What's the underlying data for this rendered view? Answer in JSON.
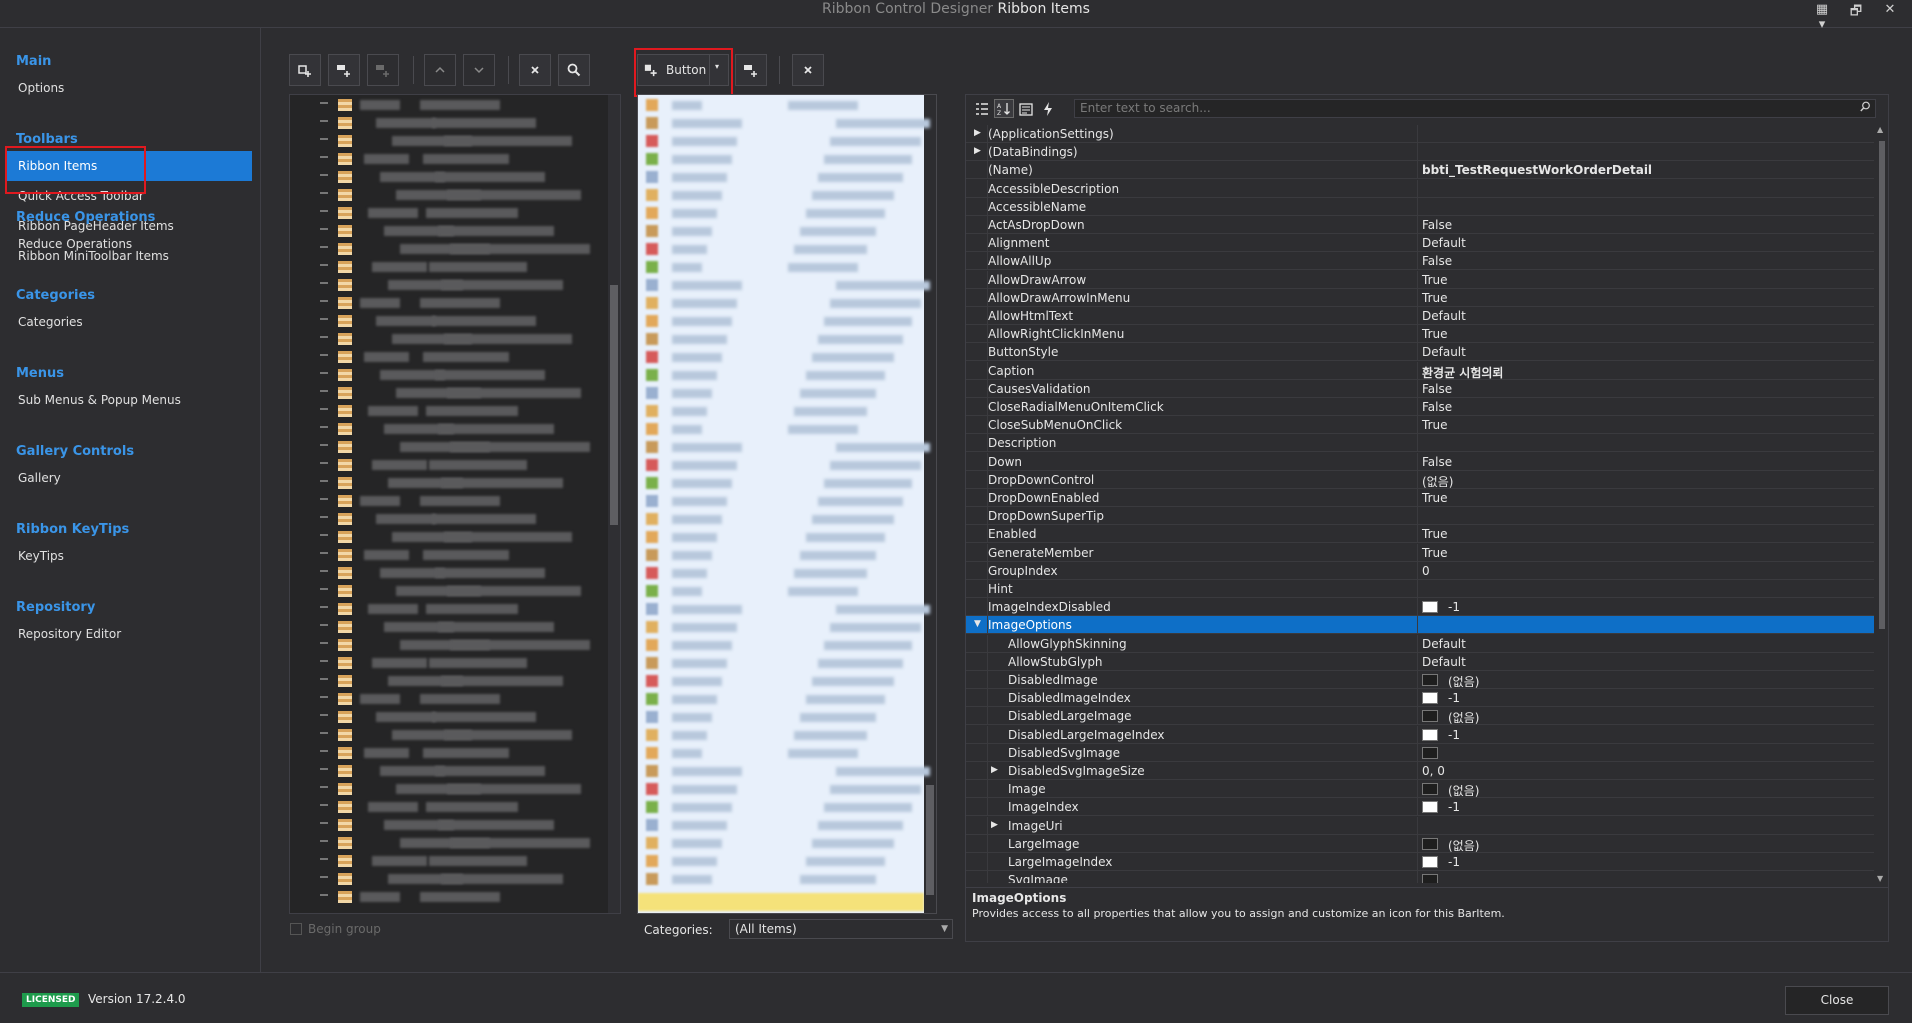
{
  "window": {
    "title_dim": "Ribbon Control Designer",
    "title_bright": "Ribbon Items",
    "buttons": [
      "▦ ▾",
      "🗗",
      "✕"
    ]
  },
  "sidebar": {
    "groups": [
      {
        "title": "Main",
        "items": [
          "Options"
        ]
      },
      {
        "title": "Toolbars",
        "items": [
          "Ribbon Items",
          "Quick Access Toolbar",
          "Ribbon PageHeader Items",
          "Ribbon MiniToolbar Items"
        ]
      },
      {
        "title": "Reduce Operations",
        "items": [
          "Reduce Operations"
        ]
      },
      {
        "title": "Categories",
        "items": [
          "Categories"
        ]
      },
      {
        "title": "Menus",
        "items": [
          "Sub Menus & Popup Menus"
        ]
      },
      {
        "title": "Gallery Controls",
        "items": [
          "Gallery"
        ]
      },
      {
        "title": "Ribbon KeyTips",
        "items": [
          "KeyTips"
        ]
      },
      {
        "title": "Repository",
        "items": [
          "Repository Editor"
        ]
      }
    ],
    "active_item": "Ribbon Items"
  },
  "toolbar": {
    "add_button_label": "Button",
    "add_icon": "add-item-icon",
    "remove_icon": "close-icon",
    "search_icon": "search-icon"
  },
  "left_panel": {
    "begin_group_label": "Begin group"
  },
  "middle_panel": {
    "categories_label": "Categories:",
    "categories_value": "(All Items)"
  },
  "properties": {
    "search_placeholder": "Enter text to search...",
    "rows": [
      {
        "name": "(ApplicationSettings)",
        "value": "",
        "expander": "▶",
        "indent": 0
      },
      {
        "name": "(DataBindings)",
        "value": "",
        "expander": "▶",
        "indent": 0
      },
      {
        "name": "(Name)",
        "value": "bbti_TestRequestWorkOrderDetail",
        "bold": true,
        "indent": 0
      },
      {
        "name": "AccessibleDescription",
        "value": "",
        "indent": 0
      },
      {
        "name": "AccessibleName",
        "value": "",
        "indent": 0
      },
      {
        "name": "ActAsDropDown",
        "value": "False",
        "indent": 0
      },
      {
        "name": "Alignment",
        "value": "Default",
        "indent": 0
      },
      {
        "name": "AllowAllUp",
        "value": "False",
        "indent": 0
      },
      {
        "name": "AllowDrawArrow",
        "value": "True",
        "indent": 0
      },
      {
        "name": "AllowDrawArrowInMenu",
        "value": "True",
        "indent": 0
      },
      {
        "name": "AllowHtmlText",
        "value": "Default",
        "indent": 0
      },
      {
        "name": "AllowRightClickInMenu",
        "value": "True",
        "indent": 0
      },
      {
        "name": "ButtonStyle",
        "value": "Default",
        "indent": 0
      },
      {
        "name": "Caption",
        "value": "환경균 시험의뢰",
        "bold": true,
        "indent": 0
      },
      {
        "name": "CausesValidation",
        "value": "False",
        "indent": 0
      },
      {
        "name": "CloseRadialMenuOnItemClick",
        "value": "False",
        "indent": 0
      },
      {
        "name": "CloseSubMenuOnClick",
        "value": "True",
        "indent": 0
      },
      {
        "name": "Description",
        "value": "",
        "indent": 0
      },
      {
        "name": "Down",
        "value": "False",
        "indent": 0
      },
      {
        "name": "DropDownControl",
        "value": "(없음)",
        "indent": 0
      },
      {
        "name": "DropDownEnabled",
        "value": "True",
        "indent": 0
      },
      {
        "name": "DropDownSuperTip",
        "value": "",
        "indent": 0
      },
      {
        "name": "Enabled",
        "value": "True",
        "indent": 0
      },
      {
        "name": "GenerateMember",
        "value": "True",
        "indent": 0
      },
      {
        "name": "GroupIndex",
        "value": "0",
        "indent": 0
      },
      {
        "name": "Hint",
        "value": "",
        "indent": 0
      },
      {
        "name": "ImageIndexDisabled",
        "value": "-1",
        "swatch": "white",
        "indent": 0
      },
      {
        "name": "ImageOptions",
        "value": "",
        "expander": "▼",
        "selected": true,
        "indent": 0
      },
      {
        "name": "AllowGlyphSkinning",
        "value": "Default",
        "indent": 1
      },
      {
        "name": "AllowStubGlyph",
        "value": "Default",
        "indent": 1
      },
      {
        "name": "DisabledImage",
        "value": "(없음)",
        "swatch": "dark",
        "indent": 1
      },
      {
        "name": "DisabledImageIndex",
        "value": "-1",
        "swatch": "white",
        "indent": 1
      },
      {
        "name": "DisabledLargeImage",
        "value": "(없음)",
        "swatch": "dark",
        "indent": 1
      },
      {
        "name": "DisabledLargeImageIndex",
        "value": "-1",
        "swatch": "white",
        "indent": 1
      },
      {
        "name": "DisabledSvgImage",
        "value": "",
        "swatch": "dark",
        "indent": 1
      },
      {
        "name": "DisabledSvgImageSize",
        "value": "0, 0",
        "expander": "▶",
        "indent": 1
      },
      {
        "name": "Image",
        "value": "(없음)",
        "swatch": "dark",
        "indent": 1
      },
      {
        "name": "ImageIndex",
        "value": "-1",
        "swatch": "white",
        "indent": 1
      },
      {
        "name": "ImageUri",
        "value": "",
        "expander": "▶",
        "indent": 1
      },
      {
        "name": "LargeImage",
        "value": "(없음)",
        "swatch": "dark",
        "indent": 1
      },
      {
        "name": "LargeImageIndex",
        "value": "-1",
        "swatch": "white",
        "indent": 1
      },
      {
        "name": "SvgImage",
        "value": "",
        "swatch": "dark",
        "indent": 1
      }
    ],
    "description_title": "ImageOptions",
    "description_text": "Provides access to all properties that allow you to assign and customize an icon for this BarItem."
  },
  "footer": {
    "badge": "LICENSED",
    "version": "Version 17.2.4.0",
    "close_label": "Close"
  },
  "colors": {
    "accent": "#1c7ad6",
    "group_title": "#3a95e8",
    "highlight_box": "#e0191f"
  }
}
